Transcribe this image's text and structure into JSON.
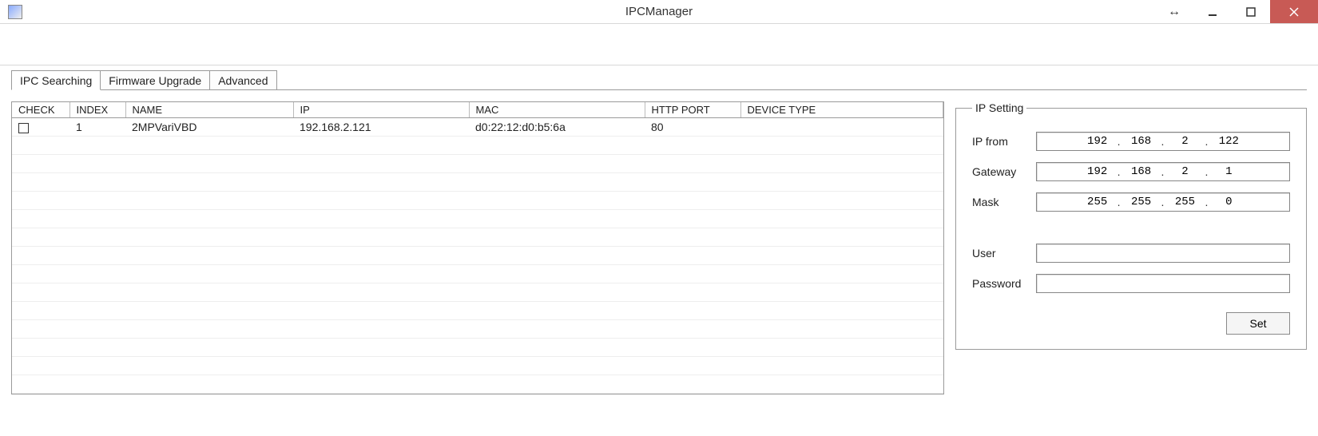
{
  "window": {
    "title": "IPCManager"
  },
  "tabs": [
    {
      "label": "IPC Searching",
      "active": true
    },
    {
      "label": "Firmware Upgrade",
      "active": false
    },
    {
      "label": "Advanced",
      "active": false
    }
  ],
  "table": {
    "headers": {
      "check": "CHECK",
      "index": "INDEX",
      "name": "NAME",
      "ip": "IP",
      "mac": "MAC",
      "http_port": "HTTP PORT",
      "device_type": "DEVICE TYPE"
    },
    "rows": [
      {
        "checked": false,
        "index": "1",
        "name": "2MPVariVBD",
        "ip": "192.168.2.121",
        "mac": "d0:22:12:d0:b5:6a",
        "http_port": "80",
        "device_type": ""
      }
    ]
  },
  "ip_setting": {
    "legend": "IP Setting",
    "labels": {
      "ip_from": "IP from",
      "gateway": "Gateway",
      "mask": "Mask",
      "user": "User",
      "password": "Password"
    },
    "ip_from": [
      "192",
      "168",
      "2",
      "122"
    ],
    "gateway": [
      "192",
      "168",
      "2",
      "1"
    ],
    "mask": [
      "255",
      "255",
      "255",
      "0"
    ],
    "user": "",
    "password": "",
    "set_label": "Set"
  }
}
